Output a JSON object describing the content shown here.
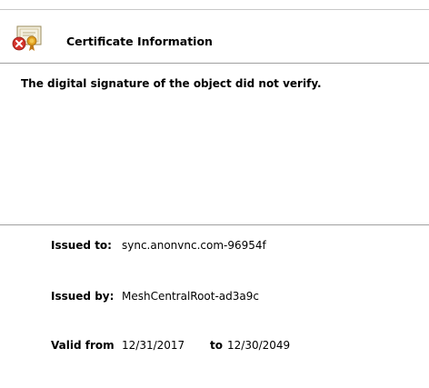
{
  "header": {
    "title": "Certificate Information",
    "icon": "certificate-error-icon"
  },
  "message": "The digital signature of the object did not verify.",
  "fields": {
    "issued_to_label": "Issued to:",
    "issued_to_value": "sync.anonvnc.com-96954f",
    "issued_by_label": "Issued by:",
    "issued_by_value": "MeshCentralRoot-ad3a9c",
    "valid_from_label": "Valid from",
    "valid_from_value": "12/31/2017",
    "valid_to_label": "to",
    "valid_to_value": "12/30/2049"
  },
  "colors": {
    "error_red": "#d4342c",
    "ribbon_gold": "#e0a020",
    "divider": "#a0a0a0"
  }
}
